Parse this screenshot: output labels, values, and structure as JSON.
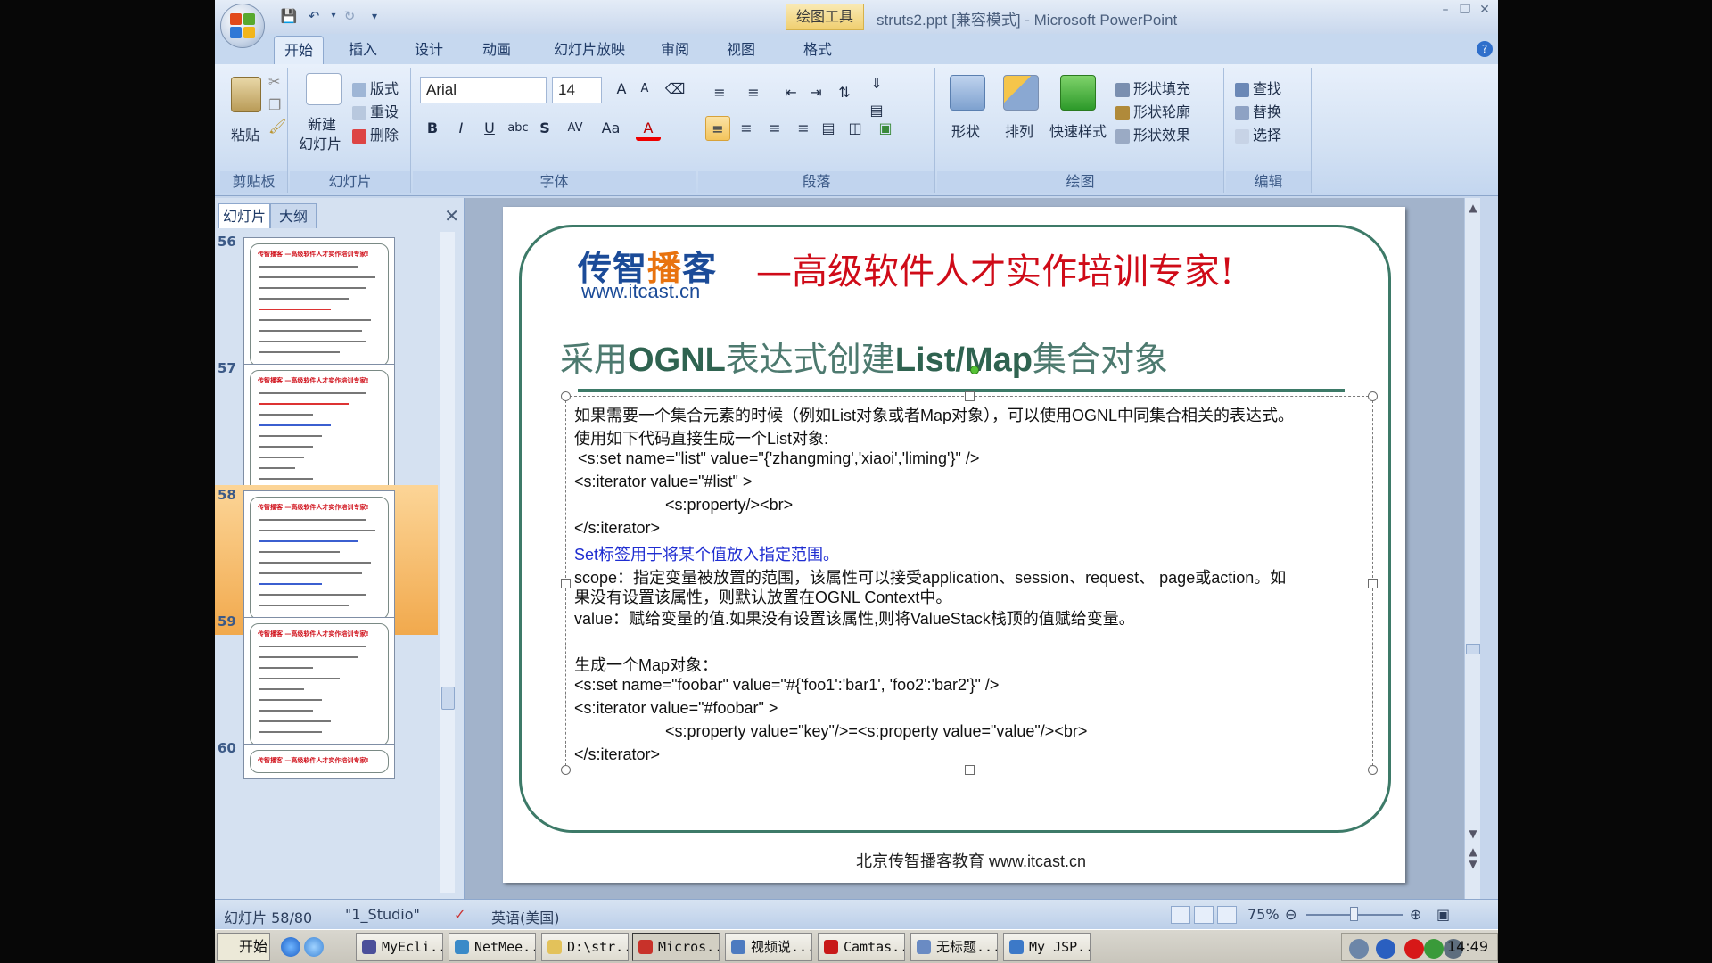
{
  "window": {
    "title": "struts2.ppt [兼容模式] - Microsoft PowerPoint",
    "context_tab": "绘图工具"
  },
  "tabs": [
    "开始",
    "插入",
    "设计",
    "动画",
    "幻灯片放映",
    "审阅",
    "视图",
    "格式"
  ],
  "active_tab": "开始",
  "ribbon": {
    "clipboard": {
      "paste": "粘贴",
      "label": "剪贴板"
    },
    "slides": {
      "new_slide_1": "新建",
      "new_slide_2": "幻灯片",
      "layout": "版式",
      "reset": "重设",
      "delete": "删除",
      "label": "幻灯片"
    },
    "font": {
      "family": "Arial",
      "size": "14",
      "label": "字体",
      "bold": "B",
      "italic": "I",
      "underline": "U",
      "strike": "abc",
      "shadow": "S",
      "spacing": "AV",
      "case": "Aa",
      "color": "A",
      "grow": "A",
      "shrink": "A"
    },
    "paragraph": {
      "label": "段落"
    },
    "drawing": {
      "shapes": "形状",
      "arrange": "排列",
      "quick_styles": "快速样式",
      "fill": "形状填充",
      "outline": "形状轮廓",
      "effects": "形状效果",
      "label": "绘图"
    },
    "editing": {
      "find": "查找",
      "replace": "替换",
      "select": "选择",
      "label": "编辑"
    }
  },
  "left_panel": {
    "tabs": [
      "幻灯片",
      "大纲"
    ],
    "thumbnails": [
      {
        "num": "56",
        "header": "传智播客 —高级软件人才实作培训专家!",
        "selected": false
      },
      {
        "num": "57",
        "header": "传智播客 —高级软件人才实作培训专家!",
        "selected": false
      },
      {
        "num": "58",
        "header": "传智播客 —高级软件人才实作培训专家!",
        "selected": true
      },
      {
        "num": "59",
        "header": "传智播客 —高级软件人才实作培训专家!",
        "selected": false
      },
      {
        "num": "60",
        "header": "传智播客 —高级软件人才实作培训专家!",
        "selected": false
      }
    ]
  },
  "slide": {
    "brand_a": "传智",
    "brand_b": "播",
    "brand_c": "客",
    "brand_url": "www.itcast.cn",
    "slogan": "—高级软件人才实作培训专家!",
    "title_p1": "采用",
    "title_p2": "OGNL",
    "title_p3": "表达式创建",
    "title_p4": "List/Map",
    "title_p5": "集合对象",
    "lines": [
      "如果需要一个集合元素的时候（例如List对象或者Map对象），可以使用OGNL中同集合相关的表达式。",
      "使用如下代码直接生成一个List对象:",
      "<s:set name=\"list\" value=\"{'zhangming','xiaoi','liming'}\" />",
      "<s:iterator value=\"#list\" >",
      "<s:property/><br>",
      "</s:iterator>",
      "Set标签用于将某个值放入指定范围。",
      "scope：指定变量被放置的范围，该属性可以接受application、session、request、 page或action。如",
      "果没有设置该属性，则默认放置在OGNL Context中。",
      "value：赋给变量的值.如果没有设置该属性,则将ValueStack栈顶的值赋给变量。",
      "生成一个Map对象：",
      "<s:set name=\"foobar\" value=\"#{'foo1':'bar1', 'foo2':'bar2'}\" />",
      "<s:iterator value=\"#foobar\" >",
      "<s:property value=\"key\"/>=<s:property value=\"value\"/><br>",
      "</s:iterator>"
    ],
    "footer": "北京传智播客教育 www.itcast.cn"
  },
  "status": {
    "slide_counter": "幻灯片 58/80",
    "theme": "\"1_Studio\"",
    "language": "英语(美国)",
    "zoom": "75%",
    "zoom_fraction": 0.5
  },
  "taskbar": {
    "start": "开始",
    "tasks": [
      "MyEcli...",
      "NetMee...",
      "D:\\str...",
      "Micros...",
      "视频说...",
      "Camtas...",
      "无标题...",
      "My JSP..."
    ],
    "active_task": "Micros...",
    "clock": "14:49"
  },
  "colors": {
    "brand_blue": "#1b4b98",
    "brand_orange": "#e8730f",
    "slogan_red": "#cf0b18",
    "frame_green": "#3d7a68",
    "blue_text": "#1f2dd1"
  }
}
